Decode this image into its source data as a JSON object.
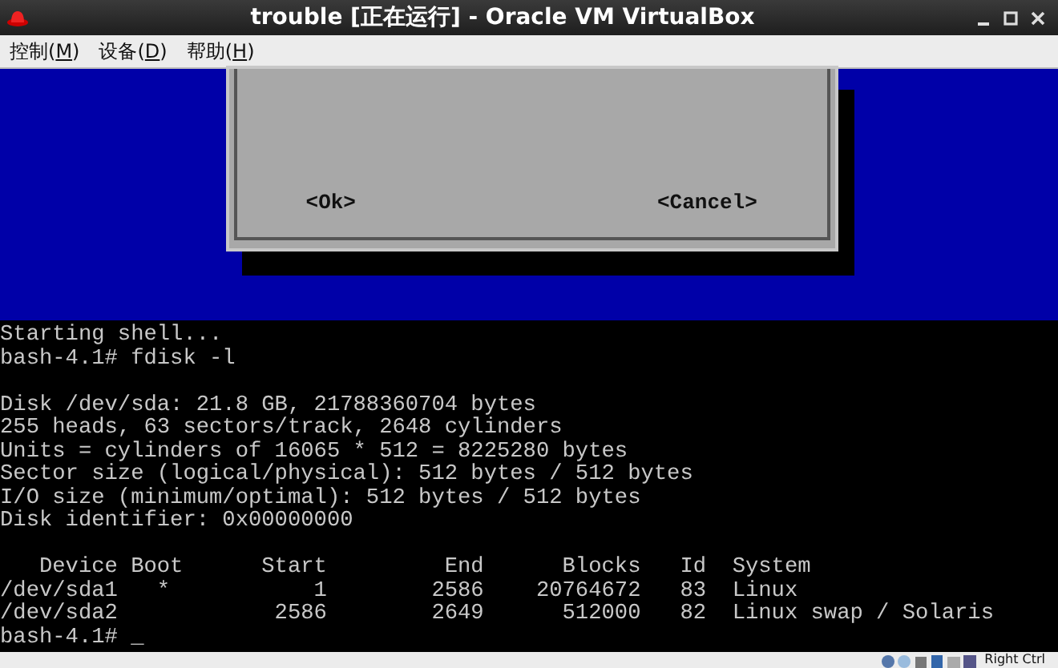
{
  "window": {
    "title": "trouble [正在运行] - Oracle VM VirtualBox"
  },
  "menu": [
    {
      "before": "控制(",
      "mnemonic": "M",
      "after": ")"
    },
    {
      "before": "设备(",
      "mnemonic": "D",
      "after": ")"
    },
    {
      "before": "帮助(",
      "mnemonic": "H",
      "after": ")"
    }
  ],
  "dialog": {
    "buttons": [
      "<Ok>",
      "<Cancel>"
    ]
  },
  "terminal": {
    "blocks": [
      [
        "Starting shell...",
        "bash-4.1# fdisk -l"
      ],
      [
        "Disk /dev/sda: 21.8 GB, 21788360704 bytes",
        "255 heads, 63 sectors/track, 2648 cylinders",
        "Units = cylinders of 16065 * 512 = 8225280 bytes",
        "Sector size (logical/physical): 512 bytes / 512 bytes",
        "I/O size (minimum/optimal): 512 bytes / 512 bytes",
        "Disk identifier: 0x00000000"
      ],
      [
        "   Device Boot      Start         End      Blocks   Id  System",
        "/dev/sda1   *           1        2586    20764672   83  Linux",
        "/dev/sda2            2586        2649      512000   82  Linux swap / Solaris",
        "bash-4.1# _"
      ]
    ]
  },
  "status_bar": {
    "host_key": "Right Ctrl"
  }
}
